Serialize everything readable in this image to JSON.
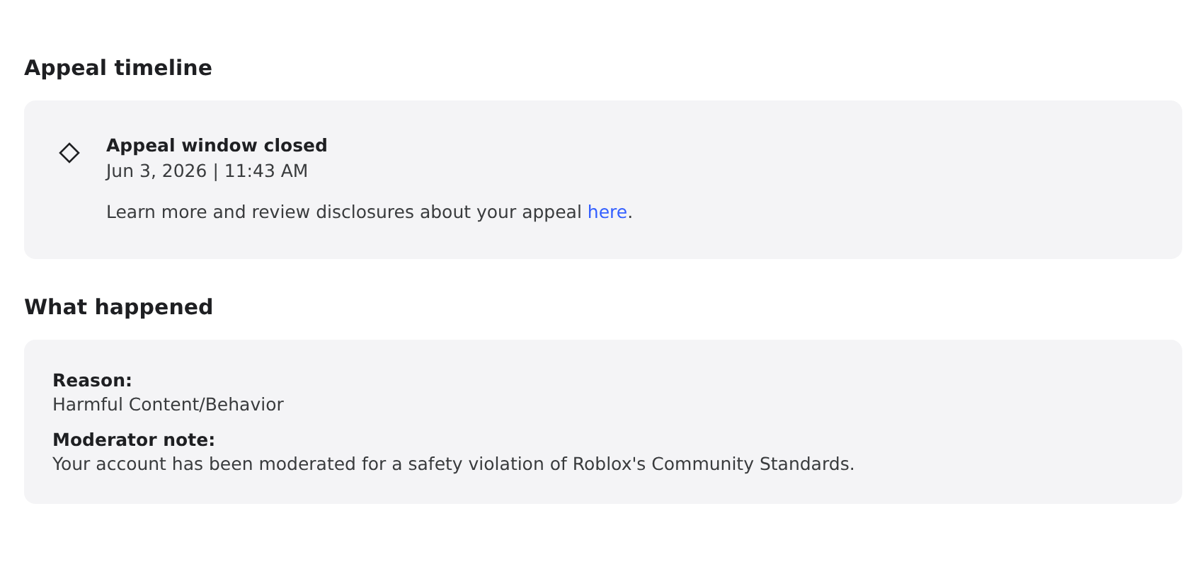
{
  "appeal_timeline": {
    "heading": "Appeal timeline",
    "event": {
      "title": "Appeal window closed",
      "date": "Jun 3, 2026 | 11:43 AM",
      "note": "Learn more and review disclosures about your appeal",
      "link": "here",
      "after_link": "."
    }
  },
  "what_happened": {
    "heading": "What happened",
    "fields": [
      {
        "label": "Reason:",
        "value": "Harmful Content/Behavior"
      },
      {
        "label": "Moderator note:",
        "value": "Your account has been moderated for a safety violation of Roblox's Community Standards."
      }
    ]
  }
}
